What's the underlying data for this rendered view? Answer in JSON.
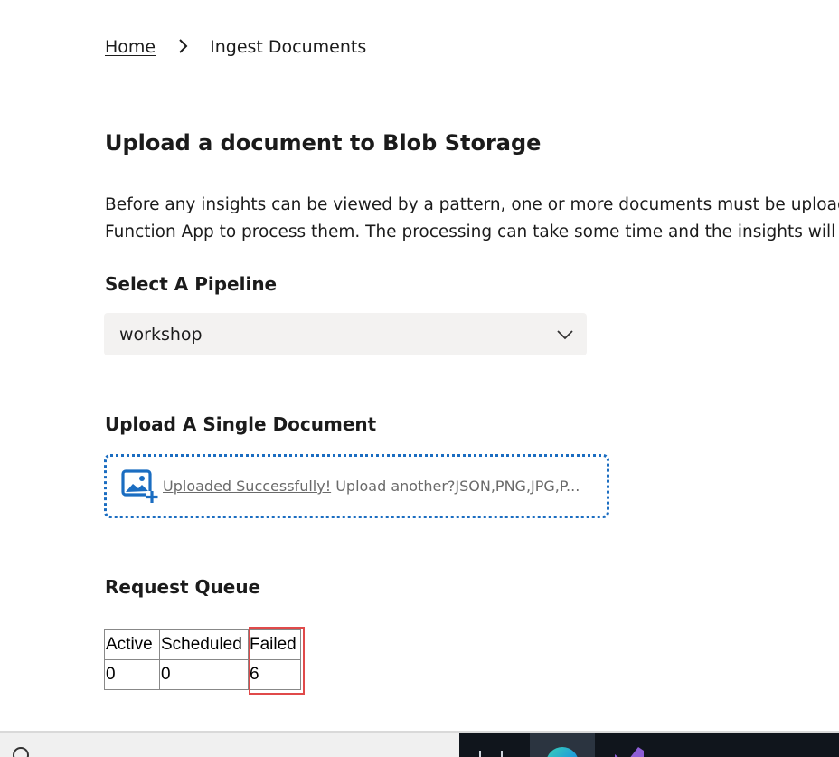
{
  "breadcrumb": {
    "home": "Home",
    "current": "Ingest Documents"
  },
  "page": {
    "title": "Upload a document to Blob Storage",
    "description_line1": "Before any insights can be viewed by a pattern, one or more documents must be uploaded to Blob Storage for the",
    "description_line2": "Function App to process them. The processing can take some time and the insights will appear once complete."
  },
  "pipeline": {
    "label": "Select A Pipeline",
    "selected": "workshop"
  },
  "upload": {
    "label": "Upload A Single Document",
    "success_text": "Uploaded Successfully!",
    "prompt_text": " Upload another?JSON,PNG,JPG,P..."
  },
  "queue": {
    "label": "Request Queue",
    "headers": [
      "Active",
      "Scheduled",
      "Failed"
    ],
    "values": [
      "0",
      "0",
      "6"
    ]
  },
  "colors": {
    "accent": "#1b6dc1",
    "highlight": "#e04a4a",
    "select_bg": "#f3f2f1"
  },
  "icons": {
    "breadcrumb_separator": "chevron-right-icon",
    "select_chevron": "chevron-down-icon",
    "upload": "add-image-icon"
  }
}
